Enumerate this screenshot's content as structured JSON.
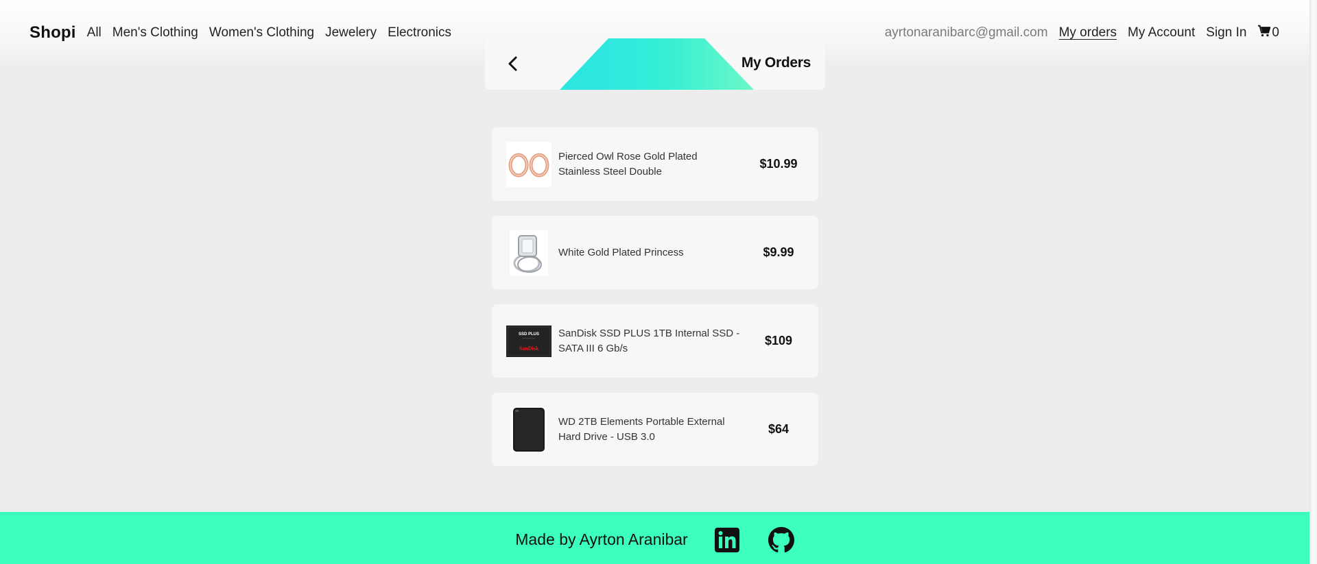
{
  "navbar": {
    "logo": "Shopi",
    "links": [
      "All",
      "Men's Clothing",
      "Women's Clothing",
      "Jewelery",
      "Electronics"
    ],
    "email": "ayrtonaranibarc@gmail.com",
    "my_orders": "My orders",
    "my_account": "My Account",
    "sign_in": "Sign In",
    "cart_count": "0"
  },
  "header": {
    "title": "My Orders",
    "back_icon": "chevron-left-icon"
  },
  "orders": [
    {
      "title": "Pierced Owl Rose Gold Plated Stainless Steel Double",
      "price": "$10.99",
      "thumb": "rose-gold-rings"
    },
    {
      "title": "White Gold Plated Princess",
      "price": "$9.99",
      "thumb": "white-gold-ring"
    },
    {
      "title": "SanDisk SSD PLUS 1TB Internal SSD - SATA III 6 Gb/s",
      "price": "$109",
      "thumb": "sandisk-ssd",
      "thumb_text_top": "SSD PLUS",
      "thumb_text_brand": "SanDisk"
    },
    {
      "title": "WD 2TB Elements Portable External Hard Drive - USB 3.0",
      "price": "$64",
      "thumb": "wd-hard-drive"
    }
  ],
  "footer": {
    "credit": "Made by Ayrton Aranibar",
    "icons": [
      "linkedin-icon",
      "github-icon"
    ]
  },
  "colors": {
    "background": "#ededed",
    "accent": "#3dffbd",
    "header_gradient_start": "#2ee6e0",
    "header_gradient_end": "#6cf7c8"
  }
}
